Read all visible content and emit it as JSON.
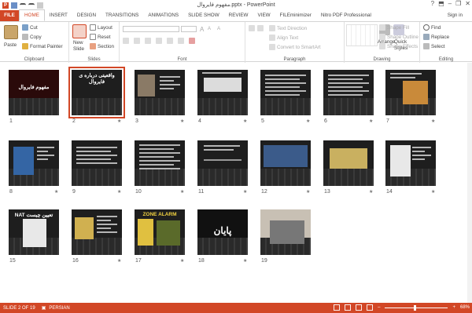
{
  "window": {
    "title": "مفهوم فايروال.pptx - PowerPoint",
    "help": "?",
    "minimize": "–",
    "restore": "❐",
    "close": "✕",
    "ribbon_toggle": "⬒"
  },
  "qat": {
    "logo": "P"
  },
  "tabs": [
    "FILE",
    "HOME",
    "INSERT",
    "DESIGN",
    "TRANSITIONS",
    "ANIMATIONS",
    "SLIDE SHOW",
    "REVIEW",
    "VIEW",
    "FILEminimizer",
    "Nitro PDF Professional"
  ],
  "signin": "Sign in",
  "ribbon": {
    "clipboard": {
      "paste": "Paste",
      "cut": "Cut",
      "copy": "Copy",
      "format_painter": "Format Painter",
      "label": "Clipboard"
    },
    "slides": {
      "new_slide": "New",
      "new_slide2": "Slide",
      "layout": "Layout",
      "reset": "Reset",
      "section": "Section",
      "label": "Slides"
    },
    "font": {
      "label": "Font",
      "grow": "A",
      "shrink": "A",
      "clear": "A"
    },
    "paragraph": {
      "text_direction": "Text Direction",
      "align_text": "Align Text",
      "convert_smartart": "Convert to SmartArt",
      "label": "Paragraph"
    },
    "drawing": {
      "arrange": "Arrange",
      "quick": "Quick",
      "styles": "Styles",
      "shape_fill": "Shape Fill",
      "shape_outline": "Shape Outline",
      "shape_effects": "Shape Effects",
      "label": "Drawing"
    },
    "editing": {
      "find": "Find",
      "replace": "Replace",
      "select": "Select",
      "label": "Editing"
    }
  },
  "slides": [
    {
      "num": "1",
      "title": "مفهوم فایروال",
      "star": ""
    },
    {
      "num": "2",
      "title": "واقعیتی درباره ی فایروال",
      "star": "★"
    },
    {
      "num": "3",
      "title": "",
      "star": "★"
    },
    {
      "num": "4",
      "title": "",
      "star": "★"
    },
    {
      "num": "5",
      "title": "",
      "star": "★"
    },
    {
      "num": "6",
      "title": "",
      "star": "★"
    },
    {
      "num": "7",
      "title": "",
      "star": "★"
    },
    {
      "num": "8",
      "title": "",
      "star": "★"
    },
    {
      "num": "9",
      "title": "",
      "star": "★"
    },
    {
      "num": "10",
      "title": "",
      "star": "★"
    },
    {
      "num": "11",
      "title": "",
      "star": "★"
    },
    {
      "num": "12",
      "title": "",
      "star": "★"
    },
    {
      "num": "13",
      "title": "",
      "star": "★"
    },
    {
      "num": "14",
      "title": "",
      "star": "★"
    },
    {
      "num": "15",
      "title": "NAT تعیین چیست",
      "star": ""
    },
    {
      "num": "16",
      "title": "",
      "star": "★"
    },
    {
      "num": "17",
      "title": "ZONE ALARM",
      "star": "★"
    },
    {
      "num": "18",
      "title": "پایان",
      "star": "★"
    },
    {
      "num": "19",
      "title": "",
      "star": ""
    }
  ],
  "status": {
    "slide_info": "SLIDE 2 OF 19",
    "language": "PERSIAN",
    "zoom": "68%",
    "minus": "–",
    "plus": "+"
  },
  "colors": {
    "accent": "#d24726"
  }
}
